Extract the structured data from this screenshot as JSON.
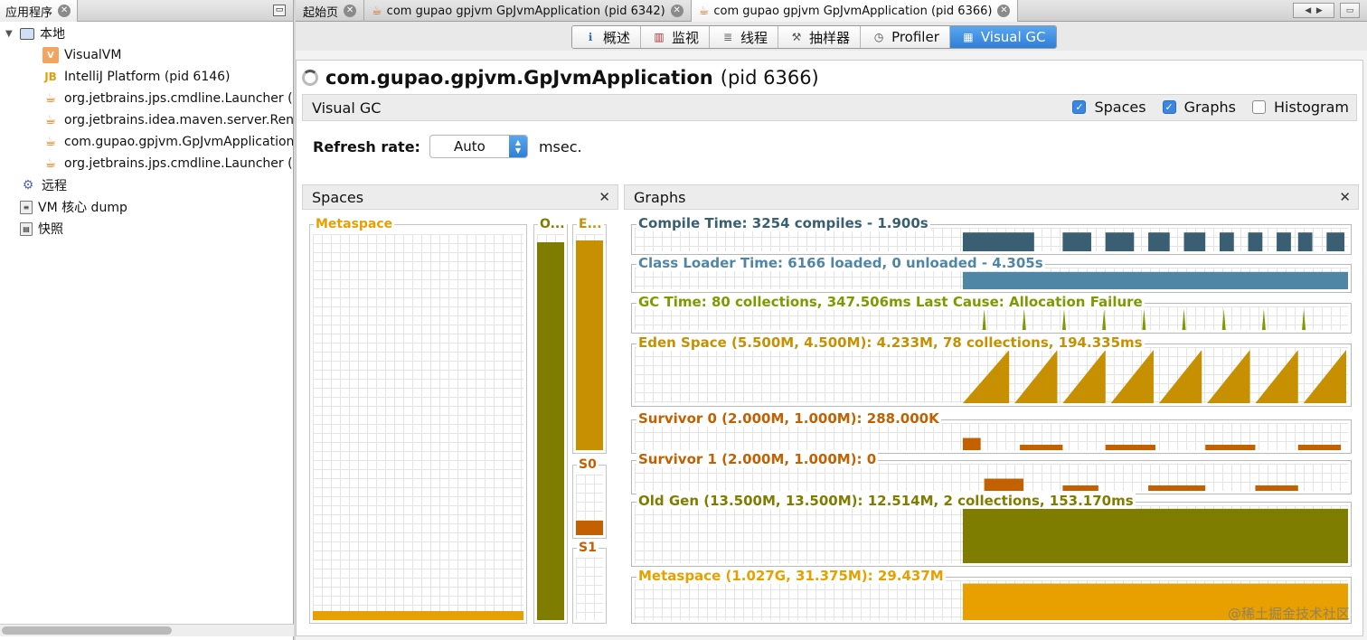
{
  "left_panel": {
    "tab_label": "应用程序",
    "tree": [
      {
        "label": "本地",
        "icon": "computer-icon",
        "level": 0,
        "expanded": true
      },
      {
        "label": "VisualVM",
        "icon": "visualvm-icon",
        "level": 1
      },
      {
        "label": "IntelliJ Platform (pid 6146)",
        "icon": "intellij-icon",
        "level": 1
      },
      {
        "label": "org.jetbrains.jps.cmdline.Launcher (",
        "icon": "java-icon",
        "level": 1
      },
      {
        "label": "org.jetbrains.idea.maven.server.Ren",
        "icon": "java-icon",
        "level": 1
      },
      {
        "label": "com.gupao.gpjvm.GpJvmApplication",
        "icon": "java-icon",
        "level": 1
      },
      {
        "label": "org.jetbrains.jps.cmdline.Launcher (",
        "icon": "java-icon",
        "level": 1
      },
      {
        "label": "远程",
        "icon": "remote-icon",
        "level": 0
      },
      {
        "label": "VM 核心 dump",
        "icon": "core-dump-icon",
        "level": 0
      },
      {
        "label": "快照",
        "icon": "snapshot-icon",
        "level": 0
      }
    ]
  },
  "doc_tabs": [
    {
      "label": "起始页",
      "active": false,
      "icon": false
    },
    {
      "label": "com gupao gpjvm GpJvmApplication (pid 6342)",
      "active": false,
      "icon": true
    },
    {
      "label": "com gupao gpjvm GpJvmApplication (pid 6366)",
      "active": true,
      "icon": true
    }
  ],
  "view_tabs": [
    {
      "label": "概述",
      "icon": "overview-icon",
      "active": false
    },
    {
      "label": "监视",
      "icon": "monitor-icon",
      "active": false
    },
    {
      "label": "线程",
      "icon": "threads-icon",
      "active": false
    },
    {
      "label": "抽样器",
      "icon": "sampler-icon",
      "active": false
    },
    {
      "label": "Profiler",
      "icon": "profiler-icon",
      "active": false
    },
    {
      "label": "Visual GC",
      "icon": "visual-gc-icon",
      "active": true
    }
  ],
  "app": {
    "title": "com.gupao.gpjvm.GpJvmApplication",
    "pid": "(pid 6366)"
  },
  "visual_gc": {
    "header": "Visual GC",
    "options": [
      {
        "label": "Spaces",
        "checked": true
      },
      {
        "label": "Graphs",
        "checked": true
      },
      {
        "label": "Histogram",
        "checked": false
      }
    ],
    "refresh_label": "Refresh rate:",
    "refresh_value": "Auto",
    "refresh_unit": "msec."
  },
  "spaces": {
    "header": "Spaces",
    "items": [
      {
        "key": "metaspace",
        "label": "Metaspace",
        "fill": 0.02,
        "color": "#e7a000"
      },
      {
        "key": "old",
        "label": "O...",
        "fill": 0.98,
        "color": "#7e7d00"
      },
      {
        "key": "eden",
        "label": "E...",
        "fill": 0.97,
        "color": "#c79000"
      },
      {
        "key": "s0",
        "label": "S0",
        "fill": 0.24,
        "color": "#c36000"
      },
      {
        "key": "s1",
        "label": "S1",
        "fill": 0.0,
        "color": "#c36000"
      }
    ]
  },
  "graphs": {
    "header": "Graphs",
    "items": [
      {
        "key": "compile",
        "label": "Compile Time: 3254 compiles - 1.900s",
        "color": "#3a5f72"
      },
      {
        "key": "classloader",
        "label": "Class Loader Time: 6166 loaded, 0 unloaded - 4.305s",
        "color": "#4f86a6"
      },
      {
        "key": "gc",
        "label": "GC Time: 80 collections, 347.506ms Last Cause: Allocation Failure",
        "color": "#7d9a00"
      },
      {
        "key": "eden",
        "label": "Eden Space (5.500M, 4.500M): 4.233M, 78 collections, 194.335ms",
        "color": "#c79000"
      },
      {
        "key": "s0",
        "label": "Survivor 0 (2.000M, 1.000M): 288.000K",
        "color": "#c36000"
      },
      {
        "key": "s1",
        "label": "Survivor 1 (2.000M, 1.000M): 0",
        "color": "#c36000"
      },
      {
        "key": "old",
        "label": "Old Gen (13.500M, 13.500M): 12.514M, 2 collections, 153.170ms",
        "color": "#7e7d00"
      },
      {
        "key": "metaspace",
        "label": "Metaspace (1.027G, 31.375M): 29.437M",
        "color": "#e7a000"
      }
    ]
  },
  "watermark": "@稀土掘金技术社区"
}
